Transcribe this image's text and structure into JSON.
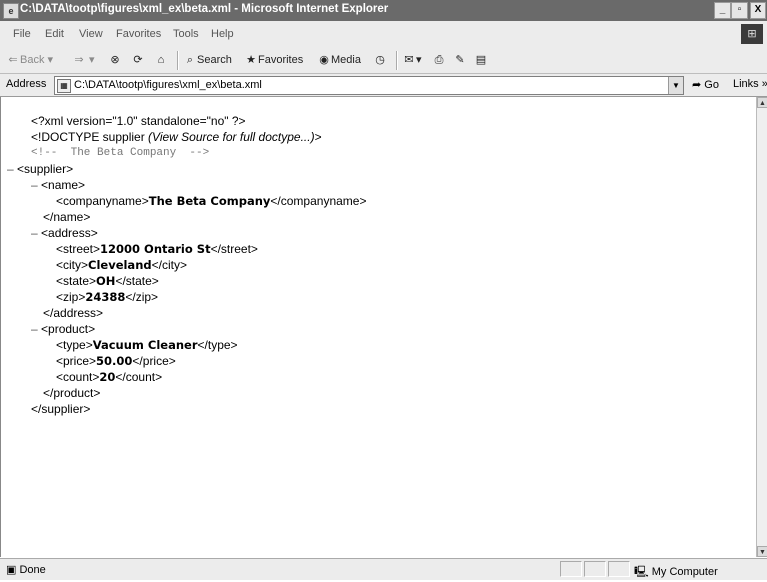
{
  "window": {
    "title": "C:\\DATA\\tootp\\figures\\xml_ex\\beta.xml - Microsoft Internet Explorer",
    "app_icon": "ie-page-icon",
    "controls": {
      "minimize": "_",
      "maximize": "▫",
      "close": "X"
    }
  },
  "menu": {
    "items": [
      "File",
      "Edit",
      "View",
      "Favorites",
      "Tools",
      "Help"
    ]
  },
  "toolbar": {
    "back": "Back",
    "search": "Search",
    "favorites": "Favorites",
    "media": "Media"
  },
  "address": {
    "label": "Address",
    "url": "C:\\DATA\\tootp\\figures\\xml_ex\\beta.xml",
    "go": "Go",
    "links": "Links »"
  },
  "document": {
    "prolog": "<?xml version=\"1.0\" standalone=\"no\" ?>",
    "doctype_open": "<!DOCTYPE supplier ",
    "doctype_note": "(View Source for full doctype...)",
    "doctype_close": ">",
    "comment": "<!--  The Beta Company  -->",
    "supplier_open": "<supplier>",
    "name_open": "<name>",
    "companyname": {
      "open": "<companyname>",
      "value": "The Beta Company",
      "close": "</companyname>"
    },
    "name_close": "</name>",
    "address_open": "<address>",
    "street": {
      "open": "<street>",
      "value": "12000 Ontario St",
      "close": "</street>"
    },
    "city": {
      "open": "<city>",
      "value": "Cleveland",
      "close": "</city>"
    },
    "state": {
      "open": "<state>",
      "value": "OH",
      "close": "</state>"
    },
    "zip": {
      "open": "<zip>",
      "value": "24388",
      "close": "</zip>"
    },
    "address_close": "</address>",
    "product_open": "<product>",
    "type": {
      "open": "<type>",
      "value": "Vacuum Cleaner",
      "close": "</type>"
    },
    "price": {
      "open": "<price>",
      "value": "50.00",
      "close": "</price>"
    },
    "count": {
      "open": "<count>",
      "value": "20",
      "close": "</count>"
    },
    "product_close": "</product>",
    "supplier_close": "</supplier>",
    "collapse_marker": "–"
  },
  "status": {
    "text": "Done",
    "zone": "My Computer"
  }
}
